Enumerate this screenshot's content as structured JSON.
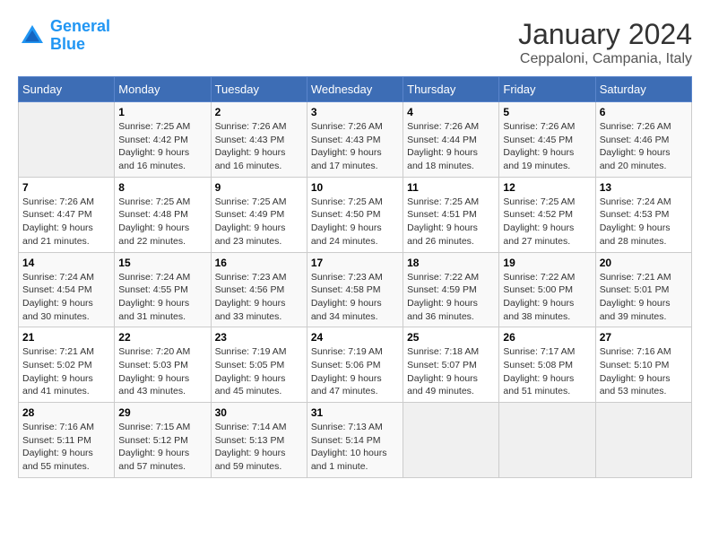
{
  "header": {
    "logo_line1": "General",
    "logo_line2": "Blue",
    "title": "January 2024",
    "subtitle": "Ceppaloni, Campania, Italy"
  },
  "calendar": {
    "weekdays": [
      "Sunday",
      "Monday",
      "Tuesday",
      "Wednesday",
      "Thursday",
      "Friday",
      "Saturday"
    ],
    "weeks": [
      [
        {
          "day": "",
          "info": ""
        },
        {
          "day": "1",
          "info": "Sunrise: 7:25 AM\nSunset: 4:42 PM\nDaylight: 9 hours\nand 16 minutes."
        },
        {
          "day": "2",
          "info": "Sunrise: 7:26 AM\nSunset: 4:43 PM\nDaylight: 9 hours\nand 16 minutes."
        },
        {
          "day": "3",
          "info": "Sunrise: 7:26 AM\nSunset: 4:43 PM\nDaylight: 9 hours\nand 17 minutes."
        },
        {
          "day": "4",
          "info": "Sunrise: 7:26 AM\nSunset: 4:44 PM\nDaylight: 9 hours\nand 18 minutes."
        },
        {
          "day": "5",
          "info": "Sunrise: 7:26 AM\nSunset: 4:45 PM\nDaylight: 9 hours\nand 19 minutes."
        },
        {
          "day": "6",
          "info": "Sunrise: 7:26 AM\nSunset: 4:46 PM\nDaylight: 9 hours\nand 20 minutes."
        }
      ],
      [
        {
          "day": "7",
          "info": "Sunrise: 7:26 AM\nSunset: 4:47 PM\nDaylight: 9 hours\nand 21 minutes."
        },
        {
          "day": "8",
          "info": "Sunrise: 7:25 AM\nSunset: 4:48 PM\nDaylight: 9 hours\nand 22 minutes."
        },
        {
          "day": "9",
          "info": "Sunrise: 7:25 AM\nSunset: 4:49 PM\nDaylight: 9 hours\nand 23 minutes."
        },
        {
          "day": "10",
          "info": "Sunrise: 7:25 AM\nSunset: 4:50 PM\nDaylight: 9 hours\nand 24 minutes."
        },
        {
          "day": "11",
          "info": "Sunrise: 7:25 AM\nSunset: 4:51 PM\nDaylight: 9 hours\nand 26 minutes."
        },
        {
          "day": "12",
          "info": "Sunrise: 7:25 AM\nSunset: 4:52 PM\nDaylight: 9 hours\nand 27 minutes."
        },
        {
          "day": "13",
          "info": "Sunrise: 7:24 AM\nSunset: 4:53 PM\nDaylight: 9 hours\nand 28 minutes."
        }
      ],
      [
        {
          "day": "14",
          "info": "Sunrise: 7:24 AM\nSunset: 4:54 PM\nDaylight: 9 hours\nand 30 minutes."
        },
        {
          "day": "15",
          "info": "Sunrise: 7:24 AM\nSunset: 4:55 PM\nDaylight: 9 hours\nand 31 minutes."
        },
        {
          "day": "16",
          "info": "Sunrise: 7:23 AM\nSunset: 4:56 PM\nDaylight: 9 hours\nand 33 minutes."
        },
        {
          "day": "17",
          "info": "Sunrise: 7:23 AM\nSunset: 4:58 PM\nDaylight: 9 hours\nand 34 minutes."
        },
        {
          "day": "18",
          "info": "Sunrise: 7:22 AM\nSunset: 4:59 PM\nDaylight: 9 hours\nand 36 minutes."
        },
        {
          "day": "19",
          "info": "Sunrise: 7:22 AM\nSunset: 5:00 PM\nDaylight: 9 hours\nand 38 minutes."
        },
        {
          "day": "20",
          "info": "Sunrise: 7:21 AM\nSunset: 5:01 PM\nDaylight: 9 hours\nand 39 minutes."
        }
      ],
      [
        {
          "day": "21",
          "info": "Sunrise: 7:21 AM\nSunset: 5:02 PM\nDaylight: 9 hours\nand 41 minutes."
        },
        {
          "day": "22",
          "info": "Sunrise: 7:20 AM\nSunset: 5:03 PM\nDaylight: 9 hours\nand 43 minutes."
        },
        {
          "day": "23",
          "info": "Sunrise: 7:19 AM\nSunset: 5:05 PM\nDaylight: 9 hours\nand 45 minutes."
        },
        {
          "day": "24",
          "info": "Sunrise: 7:19 AM\nSunset: 5:06 PM\nDaylight: 9 hours\nand 47 minutes."
        },
        {
          "day": "25",
          "info": "Sunrise: 7:18 AM\nSunset: 5:07 PM\nDaylight: 9 hours\nand 49 minutes."
        },
        {
          "day": "26",
          "info": "Sunrise: 7:17 AM\nSunset: 5:08 PM\nDaylight: 9 hours\nand 51 minutes."
        },
        {
          "day": "27",
          "info": "Sunrise: 7:16 AM\nSunset: 5:10 PM\nDaylight: 9 hours\nand 53 minutes."
        }
      ],
      [
        {
          "day": "28",
          "info": "Sunrise: 7:16 AM\nSunset: 5:11 PM\nDaylight: 9 hours\nand 55 minutes."
        },
        {
          "day": "29",
          "info": "Sunrise: 7:15 AM\nSunset: 5:12 PM\nDaylight: 9 hours\nand 57 minutes."
        },
        {
          "day": "30",
          "info": "Sunrise: 7:14 AM\nSunset: 5:13 PM\nDaylight: 9 hours\nand 59 minutes."
        },
        {
          "day": "31",
          "info": "Sunrise: 7:13 AM\nSunset: 5:14 PM\nDaylight: 10 hours\nand 1 minute."
        },
        {
          "day": "",
          "info": ""
        },
        {
          "day": "",
          "info": ""
        },
        {
          "day": "",
          "info": ""
        }
      ]
    ]
  }
}
